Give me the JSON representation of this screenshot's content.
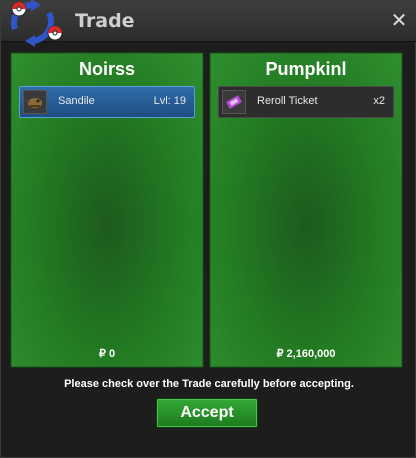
{
  "window": {
    "title": "Trade",
    "close_icon": "close-icon"
  },
  "panels": [
    {
      "player": "Noirss",
      "items": [
        {
          "name": "Sandile",
          "extra": "Lvl: 19",
          "icon": "sandile-icon",
          "selected": true
        }
      ],
      "money": "₽ 0"
    },
    {
      "player": "Pumpkinl",
      "items": [
        {
          "name": "Reroll Ticket",
          "extra": "x2",
          "icon": "reroll-ticket-icon",
          "selected": false
        }
      ],
      "money": "₽ 2,160,000"
    }
  ],
  "footer": {
    "notice": "Please check over the Trade carefully before accepting.",
    "accept_label": "Accept"
  },
  "colors": {
    "panel_green": "#237c23",
    "selected_blue": "#2f6dab",
    "accept_green": "#2a9a2a"
  }
}
